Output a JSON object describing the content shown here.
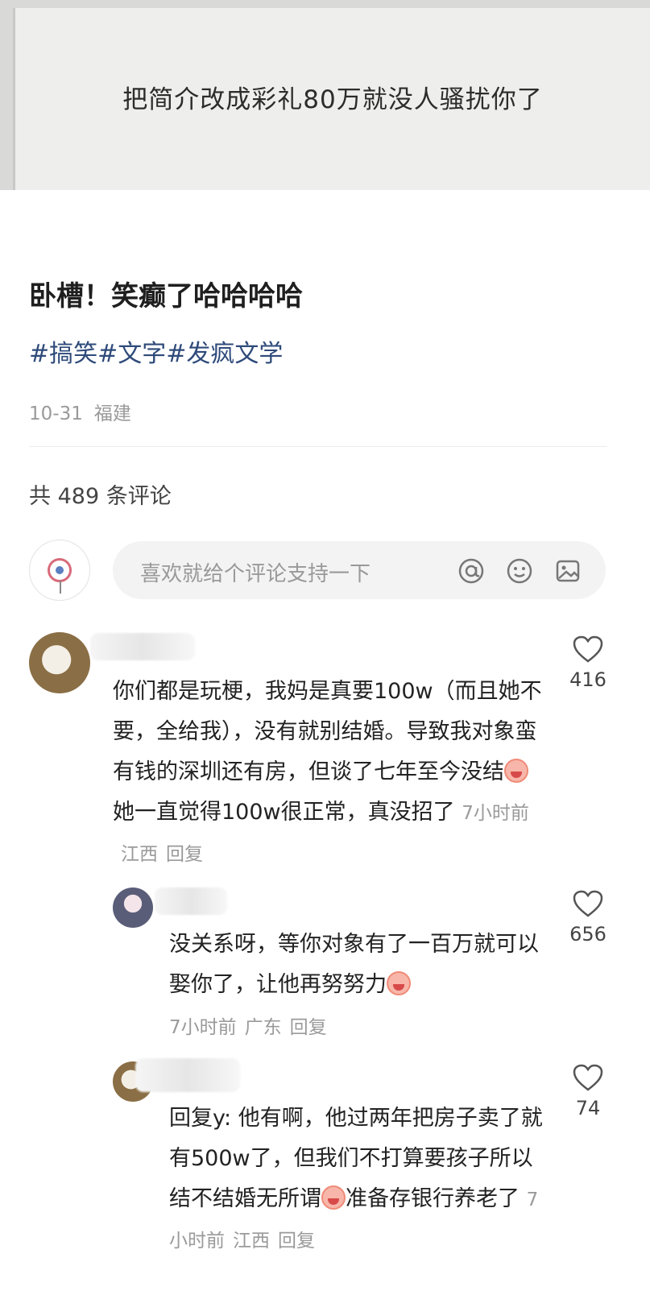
{
  "hero": {
    "text": "把简介改成彩礼80万就没人骚扰你了"
  },
  "post": {
    "title": "卧槽！笑癫了哈哈哈哈",
    "tags": "#搞笑#文字#发疯文学",
    "date": "10-31",
    "location": "福建",
    "comment_count": "共 489 条评论"
  },
  "input": {
    "placeholder": "喜欢就给个评论支持一下",
    "icons": [
      "at-icon",
      "emoji-icon",
      "image-icon"
    ]
  },
  "comments": [
    {
      "text_before": "你们都是玩梗，我妈是真要100w（而且她不要，全给我），没有就别结婚。导致我对象蛮有钱的深圳还有房，但谈了七年至今没结",
      "text_after": "她一直觉得100w很正常，真没招了",
      "time": "7小时前",
      "location": "江西",
      "reply_label": "回复",
      "likes": "416"
    },
    {
      "text_before": "没关系呀，等你对象有了一百万就可以娶你了，让他再努努力",
      "time": "7小时前",
      "location": "广东",
      "reply_label": "回复",
      "likes": "656"
    },
    {
      "text_before": "回复",
      "text_mid": "y: 他有啊，他过两年把房子卖了就有500w了，但我们不打算要孩子所以结不结婚无所谓",
      "text_after": "准备存银行养老了",
      "time": "7小时前",
      "location": "江西",
      "reply_label": "回复",
      "likes": "74"
    }
  ],
  "colors": {
    "tag": "#2e4a7a",
    "meta": "#9a9a9a"
  }
}
